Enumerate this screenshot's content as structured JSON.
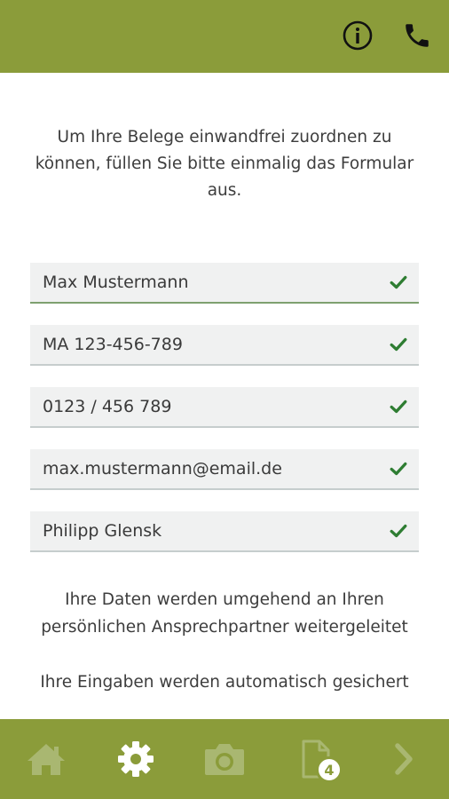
{
  "colors": {
    "brand": "#8b9c3a",
    "field_bg": "#f0f1f1",
    "check": "#2e7d32",
    "inactive_nav": "#a9b771"
  },
  "header": {
    "info_icon": "info-icon",
    "phone_icon": "phone-icon"
  },
  "intro": {
    "text": "Um Ihre Belege einwandfrei zuordnen zu können, füllen Sie bitte einmalig das Formular aus."
  },
  "form": {
    "fields": [
      {
        "value": "Max Mustermann",
        "valid": true
      },
      {
        "value": "MA 123-456-789",
        "valid": true
      },
      {
        "value": "0123 / 456 789",
        "valid": true
      },
      {
        "value": "max.mustermann@email.de",
        "valid": true
      },
      {
        "value": "Philipp Glensk",
        "valid": true
      }
    ]
  },
  "notes": {
    "forwarded": "Ihre Daten werden umgehend an Ihren persönlichen Ansprechpartner weitergeleitet",
    "autosave": "Ihre Eingaben werden automatisch gesichert"
  },
  "bottom_nav": {
    "items": [
      {
        "icon": "home-icon",
        "active": false
      },
      {
        "icon": "gear-icon",
        "active": true
      },
      {
        "icon": "camera-icon",
        "active": false
      },
      {
        "icon": "document-icon",
        "active": false,
        "badge": "4"
      },
      {
        "icon": "chevron-right-icon",
        "active": false
      }
    ]
  }
}
